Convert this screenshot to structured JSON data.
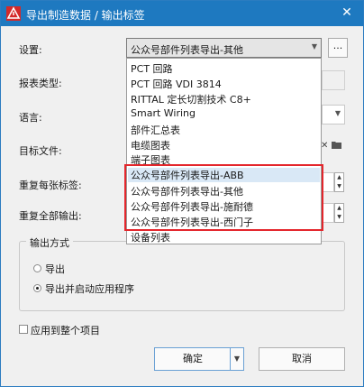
{
  "window": {
    "title": "导出制造数据 / 输出标签",
    "close_label": "✕"
  },
  "settings": {
    "label": "设置:",
    "selected_value": "公众号部件列表导出-其他",
    "more_button": "..."
  },
  "labels": {
    "report_type": "报表类型:",
    "language": "语言:",
    "target_file": "目标文件:",
    "repeat_each_label": "重复每张标签:",
    "repeat_all_output": "重复全部输出:"
  },
  "dropdown": {
    "items": [
      "PCT 回路",
      "PCT 回路 VDI 3814",
      "RITTAL 定长切割技术 C8+",
      "Smart Wiring",
      "部件汇总表",
      "电缆图表",
      "端子图表",
      "公众号部件列表导出-ABB",
      "公众号部件列表导出-其他",
      "公众号部件列表导出-施耐德",
      "公众号部件列表导出-西门子",
      "设备列表"
    ],
    "hovered_index": 7
  },
  "output_mode": {
    "group_title": "输出方式",
    "options": [
      "导出",
      "导出并启动应用程序"
    ],
    "selected_index": 1
  },
  "apply_to_project": {
    "label": "应用到整个项目",
    "checked": false
  },
  "buttons": {
    "ok": "确定",
    "cancel": "取消"
  },
  "colors": {
    "titlebar": "#1e79c0",
    "highlight": "#e4262c",
    "hover": "#d9e8f6"
  }
}
